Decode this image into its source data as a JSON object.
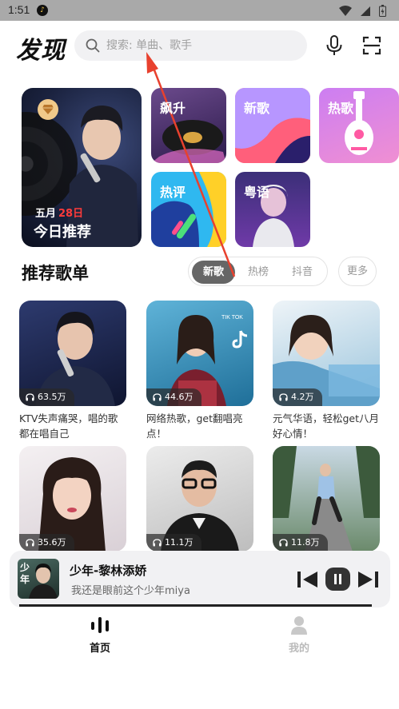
{
  "status_bar": {
    "time": "1:51"
  },
  "header": {
    "title": "发现",
    "search_placeholder": "搜索: 单曲、歌手"
  },
  "daily": {
    "month": "五月",
    "day": "28日",
    "label": "今日推荐"
  },
  "tiles": [
    {
      "label": "飙升"
    },
    {
      "label": "新歌"
    },
    {
      "label": "热歌"
    },
    {
      "label": "热评"
    },
    {
      "label": "粤语"
    }
  ],
  "section": {
    "title": "推荐歌单",
    "tabs": [
      {
        "label": "新歌"
      },
      {
        "label": "热榜"
      },
      {
        "label": "抖音"
      }
    ],
    "more": "更多"
  },
  "playlists": [
    {
      "count": "63.5万",
      "desc": "KTV失声痛哭，唱的歌都在唱自己"
    },
    {
      "count": "44.6万",
      "desc": "网络热歌，get翻唱亮点！"
    },
    {
      "count": "4.2万",
      "desc": "元气华语，轻松get八月好心情！"
    },
    {
      "count": "35.6万",
      "desc": ""
    },
    {
      "count": "11.1万",
      "desc": ""
    },
    {
      "count": "11.8万",
      "desc": ""
    }
  ],
  "tiktok_text": "TIK TOK",
  "mini_player": {
    "title": "少年-黎林添娇",
    "subtitle": "我还是眼前这个少年miya",
    "cover_text": "少年"
  },
  "nav": {
    "home": "首页",
    "me": "我的"
  },
  "colors": {
    "accent_red": "#ff3b3b",
    "nav_active": "#111111",
    "annotation_arrow": "#e8412e"
  }
}
